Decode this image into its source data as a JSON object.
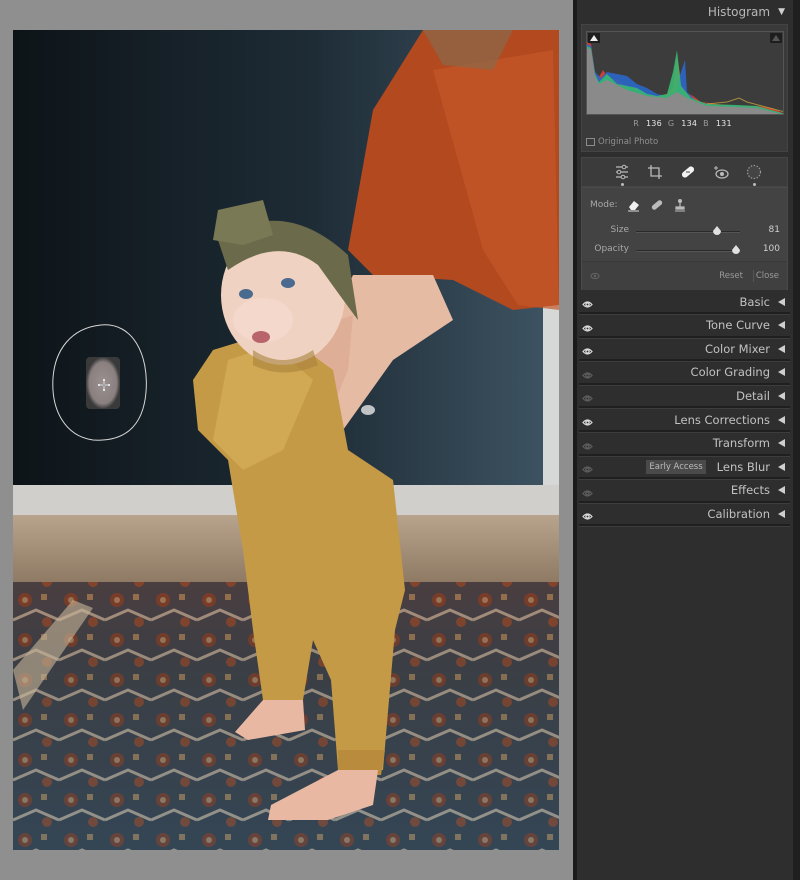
{
  "canvas": {
    "background": "#8f8f8f",
    "photo_description": "Baby in mustard romper and olive headband standing on patterned rug, held by adult in rust sweater, dark blue wall",
    "heal_spot": {
      "cursor_icon": "crosshair-icon"
    }
  },
  "histogram": {
    "title": "Histogram",
    "collapse_icon": "triangle-down-icon",
    "readout": {
      "r_label": "R",
      "r_value": "136",
      "g_label": "G",
      "g_value": "134",
      "b_label": "B",
      "b_value": "131"
    },
    "original_photo_label": "Original Photo",
    "original_photo_checked": false
  },
  "tools": [
    {
      "name": "edit",
      "icon": "sliders-icon",
      "active": false,
      "dot": true
    },
    {
      "name": "crop",
      "icon": "crop-icon",
      "active": false,
      "dot": false
    },
    {
      "name": "healing",
      "icon": "bandage-icon",
      "active": true,
      "dot": false
    },
    {
      "name": "red-eye",
      "icon": "red-eye-icon",
      "active": false,
      "dot": false
    },
    {
      "name": "masking",
      "icon": "masking-icon",
      "active": false,
      "dot": true
    }
  ],
  "healing": {
    "mode_label": "Mode:",
    "modes": [
      {
        "name": "content-aware-remove",
        "icon": "eraser-icon",
        "active": true
      },
      {
        "name": "heal",
        "icon": "bandage-icon",
        "active": false
      },
      {
        "name": "clone",
        "icon": "stamp-icon",
        "active": false
      }
    ],
    "size": {
      "label": "Size",
      "value": "81",
      "fraction": 0.78
    },
    "opacity": {
      "label": "Opacity",
      "value": "100",
      "fraction": 1.0
    },
    "reset_label": "Reset",
    "close_label": "Close"
  },
  "sections": [
    {
      "label": "Basic",
      "visible": true,
      "badge": null
    },
    {
      "label": "Tone Curve",
      "visible": true,
      "badge": null
    },
    {
      "label": "Color Mixer",
      "visible": true,
      "badge": null
    },
    {
      "label": "Color Grading",
      "visible": false,
      "badge": null
    },
    {
      "label": "Detail",
      "visible": false,
      "badge": null
    },
    {
      "label": "Lens Corrections",
      "visible": true,
      "badge": null
    },
    {
      "label": "Transform",
      "visible": false,
      "badge": null
    },
    {
      "label": "Lens Blur",
      "visible": false,
      "badge": "Early Access"
    },
    {
      "label": "Effects",
      "visible": false,
      "badge": null
    },
    {
      "label": "Calibration",
      "visible": true,
      "badge": null
    }
  ]
}
